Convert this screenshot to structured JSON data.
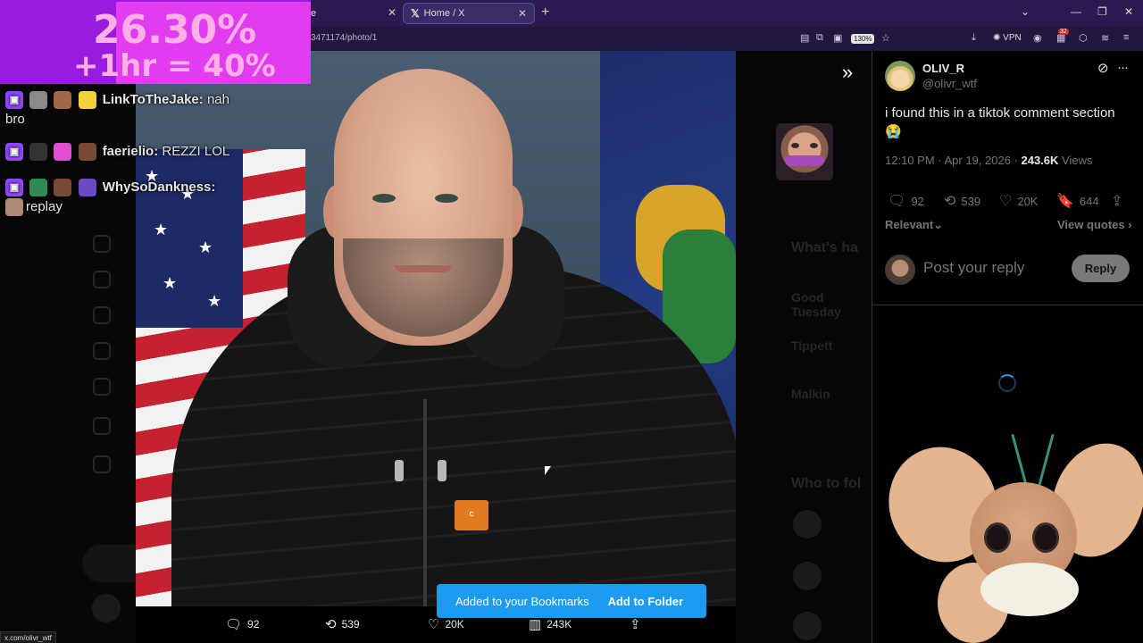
{
  "browser": {
    "inactive_tab_suffix": "e",
    "active_tab_title": "Home / X",
    "url_fragment": "3471174/photo/1",
    "zoom": "130%",
    "vpn_label": "VPN",
    "notif_count": "32",
    "status_url": "x.com/olivr_wtf"
  },
  "stream_overlay": {
    "goal_line1": "26.30%",
    "goal_line2": "+1hr = 40%",
    "chat": [
      {
        "user": "LinkToTheJake:",
        "message": " nah",
        "cont": "bro"
      },
      {
        "user": "faerielio:",
        "message": " REZZI LOL",
        "cont": ""
      },
      {
        "user": "WhySoDankness:",
        "message": "",
        "cont": "replay"
      }
    ]
  },
  "photo_actions": {
    "replies": "92",
    "reposts": "539",
    "likes": "20K",
    "views": "243K"
  },
  "toast": {
    "message": "Added to your Bookmarks",
    "action": "Add to Folder"
  },
  "tweet": {
    "author_name": "OLIV_R",
    "author_handle": "@olivr_wtf",
    "text": "i found this in a tiktok comment section",
    "emoji": "😭",
    "time": "12:10 PM · Apr 19, 2026 · ",
    "views_count": "243.6K",
    "views_label": " Views",
    "replies": "92",
    "reposts": "539",
    "likes": "20K",
    "bookmarks": "644",
    "sort_label": "Relevant",
    "view_quotes": "View quotes",
    "reply_placeholder": "Post your reply",
    "reply_button": "Reply"
  },
  "icons": {
    "reply": "reply-icon",
    "repost": "repost-icon",
    "like": "heart-icon",
    "bookmark": "bookmark-icon",
    "share": "share-icon",
    "views": "views-icon"
  },
  "colors": {
    "accent": "#1d9bf0",
    "overlay_purple": "#9a1adf",
    "overlay_pink": "#e23cf0"
  }
}
